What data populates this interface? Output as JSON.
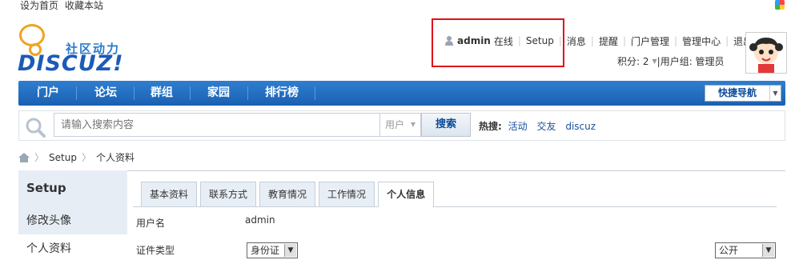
{
  "topbar": {
    "set_home": "设为首页",
    "bookmark": "收藏本站"
  },
  "logo": {
    "cn": "社区动力",
    "en": "DISCUZ!"
  },
  "user": {
    "name": "admin",
    "status": "在线",
    "links": [
      "Setup",
      "消息",
      "提醒",
      "门户管理",
      "管理中心",
      "退出"
    ],
    "credits": "积分: 2",
    "group": "用户组: 管理员"
  },
  "nav": {
    "items": [
      "门户",
      "论坛",
      "群组",
      "家园",
      "排行榜"
    ],
    "quick_nav": "快捷导航"
  },
  "search": {
    "placeholder": "请输入搜索内容",
    "type": "用户",
    "button": "搜索",
    "hot_label": "热搜:",
    "hot_words": [
      "活动",
      "交友",
      "discuz"
    ]
  },
  "breadcrumb": {
    "items": [
      "Setup",
      "个人资料"
    ]
  },
  "sidebar": {
    "title": "Setup",
    "items": [
      "修改头像",
      "个人资料"
    ]
  },
  "tabs": [
    "基本资料",
    "联系方式",
    "教育情况",
    "工作情况",
    "个人信息"
  ],
  "form": {
    "username_label": "用户名",
    "username_value": "admin",
    "idtype_label": "证件类型",
    "idtype_value": "身份证",
    "privacy_value": "公开"
  },
  "colors": {
    "nav": "#1a60b2",
    "highlight": "#e0101a",
    "sidebar": "#e6edf5"
  }
}
